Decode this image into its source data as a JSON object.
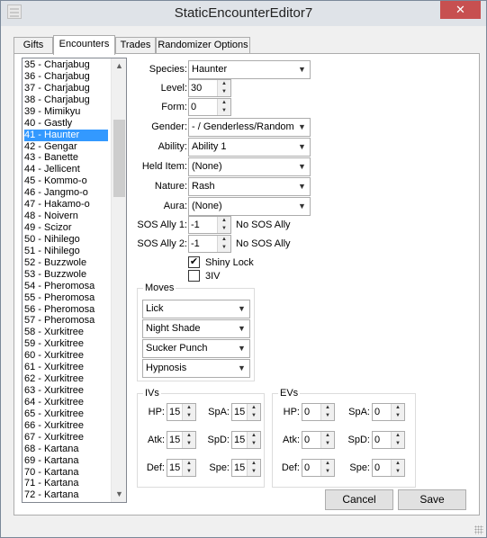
{
  "window": {
    "title": "StaticEncounterEditor7",
    "close_glyph": "✕"
  },
  "tabs": [
    "Gifts",
    "Encounters",
    "Trades",
    "Randomizer Options"
  ],
  "encounter_list": {
    "items": [
      "35 - Charjabug",
      "36 - Charjabug",
      "37 - Charjabug",
      "38 - Charjabug",
      "39 - Mimikyu",
      "40 - Gastly",
      "41 - Haunter",
      "42 - Gengar",
      "43 - Banette",
      "44 - Jellicent",
      "45 - Kommo-o",
      "46 - Jangmo-o",
      "47 - Hakamo-o",
      "48 - Noivern",
      "49 - Scizor",
      "50 - Nihilego",
      "51 - Nihilego",
      "52 - Buzzwole",
      "53 - Buzzwole",
      "54 - Pheromosa",
      "55 - Pheromosa",
      "56 - Pheromosa",
      "57 - Pheromosa",
      "58 - Xurkitree",
      "59 - Xurkitree",
      "60 - Xurkitree",
      "61 - Xurkitree",
      "62 - Xurkitree",
      "63 - Xurkitree",
      "64 - Xurkitree",
      "65 - Xurkitree",
      "66 - Xurkitree",
      "67 - Xurkitree",
      "68 - Kartana",
      "69 - Kartana",
      "70 - Kartana",
      "71 - Kartana",
      "72 - Kartana"
    ],
    "selected_index": 6,
    "scroll_up_glyph": "▲",
    "scroll_down_glyph": "▼"
  },
  "fields": {
    "species": {
      "label": "Species:",
      "value": "Haunter"
    },
    "level": {
      "label": "Level:",
      "value": "30"
    },
    "form": {
      "label": "Form:",
      "value": "0"
    },
    "gender": {
      "label": "Gender:",
      "value": "- / Genderless/Random"
    },
    "ability": {
      "label": "Ability:",
      "value": "Ability 1"
    },
    "held_item": {
      "label": "Held Item:",
      "value": "(None)"
    },
    "nature": {
      "label": "Nature:",
      "value": "Rash"
    },
    "aura": {
      "label": "Aura:",
      "value": "(None)"
    },
    "sos_ally_1": {
      "label": "SOS Ally 1:",
      "value": "-1",
      "note": "No SOS Ally"
    },
    "sos_ally_2": {
      "label": "SOS Ally 2:",
      "value": "-1",
      "note": "No SOS Ally"
    },
    "shiny_lock": {
      "label": "Shiny Lock",
      "checked": true,
      "check_glyph": "✔"
    },
    "three_iv": {
      "label": "3IV",
      "checked": false
    }
  },
  "moves": {
    "title": "Moves",
    "items": [
      "Lick",
      "Night Shade",
      "Sucker Punch",
      "Hypnosis"
    ]
  },
  "ivs": {
    "title": "IVs",
    "hp": {
      "label": "HP:",
      "value": "15"
    },
    "atk": {
      "label": "Atk:",
      "value": "15"
    },
    "def": {
      "label": "Def:",
      "value": "15"
    },
    "spa": {
      "label": "SpA:",
      "value": "15"
    },
    "spd": {
      "label": "SpD:",
      "value": "15"
    },
    "spe": {
      "label": "Spe:",
      "value": "15"
    }
  },
  "evs": {
    "title": "EVs",
    "hp": {
      "label": "HP:",
      "value": "0"
    },
    "atk": {
      "label": "Atk:",
      "value": "0"
    },
    "def": {
      "label": "Def:",
      "value": "0"
    },
    "spa": {
      "label": "SpA:",
      "value": "0"
    },
    "spd": {
      "label": "SpD:",
      "value": "0"
    },
    "spe": {
      "label": "Spe:",
      "value": "0"
    }
  },
  "buttons": {
    "cancel": "Cancel",
    "save": "Save"
  },
  "glyphs": {
    "dropdown": "▼",
    "spin_up": "▲",
    "spin_down": "▼"
  }
}
